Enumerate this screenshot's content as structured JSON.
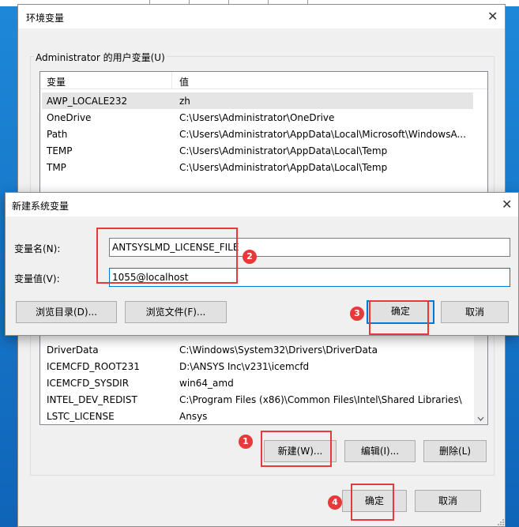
{
  "env_window": {
    "title": "环境变量",
    "user_group_label": "Administrator 的用户变量(U)",
    "user_columns": [
      "变量",
      "值"
    ],
    "user_rows": [
      {
        "name": "AWP_LOCALE232",
        "value": "zh"
      },
      {
        "name": "OneDrive",
        "value": "C:\\Users\\Administrator\\OneDrive"
      },
      {
        "name": "Path",
        "value": "C:\\Users\\Administrator\\AppData\\Local\\Microsoft\\WindowsA..."
      },
      {
        "name": "TEMP",
        "value": "C:\\Users\\Administrator\\AppData\\Local\\Temp"
      },
      {
        "name": "TMP",
        "value": "C:\\Users\\Administrator\\AppData\\Local\\Temp"
      }
    ],
    "system_rows": [
      {
        "name": "DriverData",
        "value": "C:\\Windows\\System32\\Drivers\\DriverData"
      },
      {
        "name": "ICEMCFD_ROOT231",
        "value": "D:\\ANSYS Inc\\v231\\icemcfd"
      },
      {
        "name": "ICEMCFD_SYSDIR",
        "value": "win64_amd"
      },
      {
        "name": "INTEL_DEV_REDIST",
        "value": "C:\\Program Files (x86)\\Common Files\\Intel\\Shared Libraries\\"
      },
      {
        "name": "LSTC_LICENSE",
        "value": "Ansys"
      }
    ],
    "new_button": "新建(W)...",
    "edit_button": "编辑(I)...",
    "delete_button": "删除(L)",
    "ok_button": "确定",
    "cancel_button": "取消"
  },
  "new_var_dialog": {
    "title": "新建系统变量",
    "name_label": "变量名(N):",
    "name_value": "ANTSYSLMD_LICENSE_FILE",
    "value_label": "变量值(V):",
    "value_value": "1055@localhost",
    "browse_dir_button": "浏览目录(D)...",
    "browse_file_button": "浏览文件(F)...",
    "ok_button": "确定",
    "cancel_button": "取消"
  },
  "annotations": [
    "1",
    "2",
    "3",
    "4"
  ],
  "colors": {
    "annotation": "#e8393a",
    "focus": "#0078d7"
  }
}
